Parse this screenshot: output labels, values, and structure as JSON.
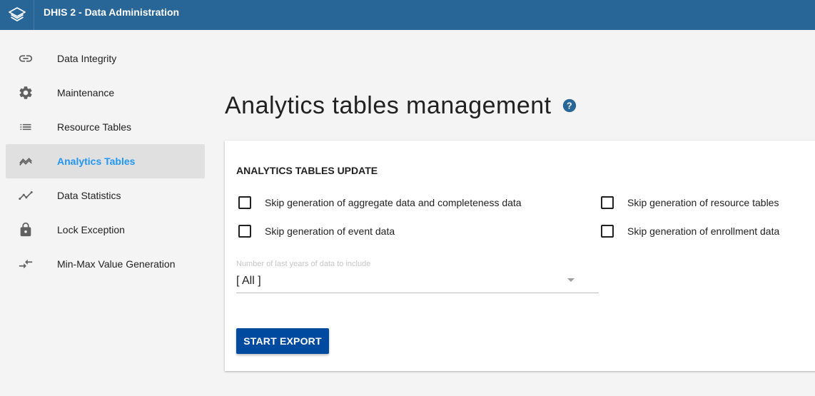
{
  "header": {
    "title": "DHIS 2 - Data Administration",
    "background_color": "#276696",
    "logo_icon": "dhis2-logo-icon"
  },
  "sidebar": {
    "items": [
      {
        "label": "Data Integrity",
        "icon": "link-icon",
        "active": false
      },
      {
        "label": "Maintenance",
        "icon": "gear-icon",
        "active": false
      },
      {
        "label": "Resource Tables",
        "icon": "list-icon",
        "active": false
      },
      {
        "label": "Analytics Tables",
        "icon": "trending-icon",
        "active": true
      },
      {
        "label": "Data Statistics",
        "icon": "line-chart-icon",
        "active": false
      },
      {
        "label": "Lock Exception",
        "icon": "lock-icon",
        "active": false
      },
      {
        "label": "Min-Max Value Generation",
        "icon": "compare-arrows-icon",
        "active": false
      }
    ],
    "active_color": "#2196f3"
  },
  "main": {
    "title": "Analytics tables management",
    "help_icon": "help-icon",
    "card": {
      "title": "ANALYTICS TABLES UPDATE",
      "checkboxes": [
        {
          "label": "Skip generation of aggregate data and completeness data",
          "checked": false
        },
        {
          "label": "Skip generation of resource tables",
          "checked": false
        },
        {
          "label": "Skip generation of event data",
          "checked": false
        },
        {
          "label": "Skip generation of enrollment data",
          "checked": false
        }
      ],
      "years_select": {
        "floating_label": "Number of last years of data to include",
        "value": "[ All ]"
      },
      "start_button_label": "START EXPORT",
      "button_color": "#004ba0"
    }
  }
}
